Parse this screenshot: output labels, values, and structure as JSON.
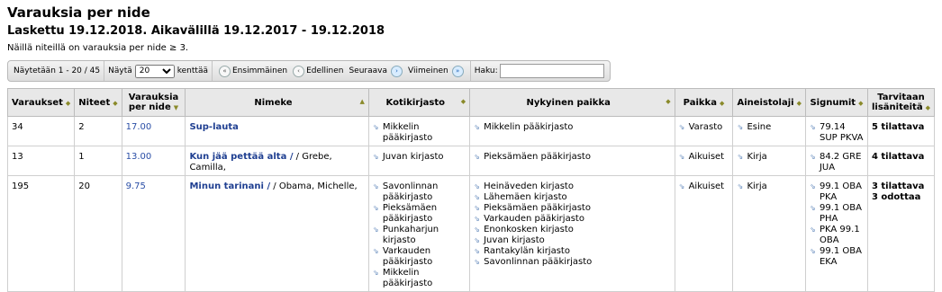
{
  "page": {
    "title": "Varauksia per nide",
    "subtitle": "Laskettu 19.12.2018. Aikavälillä 19.12.2017 - 19.12.2018",
    "note": "Näillä niteillä on varauksia per nide ≥ 3."
  },
  "pager": {
    "showing": "Näytetään 1 - 20 / 45",
    "show_label": "Näytä",
    "page_size": "20",
    "fields_label": "kenttää",
    "first": "Ensimmäinen",
    "prev": "Edellinen",
    "next": "Seuraava",
    "last": "Viimeinen",
    "search_label": "Haku:"
  },
  "columns": [
    "Varaukset",
    "Niteet",
    "Varauksia per nide",
    "Nimeke",
    "Kotikirjasto",
    "Nykyinen paikka",
    "Paikka",
    "Aineistolaji",
    "Signumit",
    "Tarvitaan lisäniteitä"
  ],
  "rows": [
    {
      "holds": "34",
      "items": "2",
      "ratio": "17.00",
      "title": "Sup-lauta",
      "author": "",
      "home": [
        "Mikkelin pääkirjasto"
      ],
      "current": [
        "Mikkelin pääkirjasto"
      ],
      "location": [
        "Varasto"
      ],
      "type": [
        "Esine"
      ],
      "callnums": [
        "79.14 SUP PKVA"
      ],
      "needed": [
        "5 tilattava"
      ]
    },
    {
      "holds": "13",
      "items": "1",
      "ratio": "13.00",
      "title": "Kun jää pettää alta /",
      "author": " / Grebe, Camilla,",
      "home": [
        "Juvan kirjasto"
      ],
      "current": [
        "Pieksämäen pääkirjasto"
      ],
      "location": [
        "Aikuiset"
      ],
      "type": [
        "Kirja"
      ],
      "callnums": [
        "84.2 GRE JUA"
      ],
      "needed": [
        "4 tilattava"
      ]
    },
    {
      "holds": "195",
      "items": "20",
      "ratio": "9.75",
      "title": "Minun tarinani /",
      "author": " / Obama, Michelle,",
      "home": [
        "Savonlinnan pääkirjasto",
        "Pieksämäen pääkirjasto",
        "Punkaharjun kirjasto",
        "Varkauden pääkirjasto",
        "Mikkelin pääkirjasto"
      ],
      "current": [
        "Heinäveden kirjasto",
        "Lähemäen kirjasto",
        "Pieksämäen pääkirjasto",
        "Varkauden pääkirjasto",
        "Enonkosken kirjasto",
        "Juvan kirjasto",
        "Rantakylän kirjasto",
        "Savonlinnan pääkirjasto"
      ],
      "location": [
        "Aikuiset"
      ],
      "type": [
        "Kirja"
      ],
      "callnums": [
        "99.1 OBA PKA",
        "99.1 OBA PHA",
        "PKA 99.1 OBA",
        "99.1 OBA EKA"
      ],
      "needed": [
        "3 tilattava",
        "3 odottaa"
      ]
    }
  ]
}
